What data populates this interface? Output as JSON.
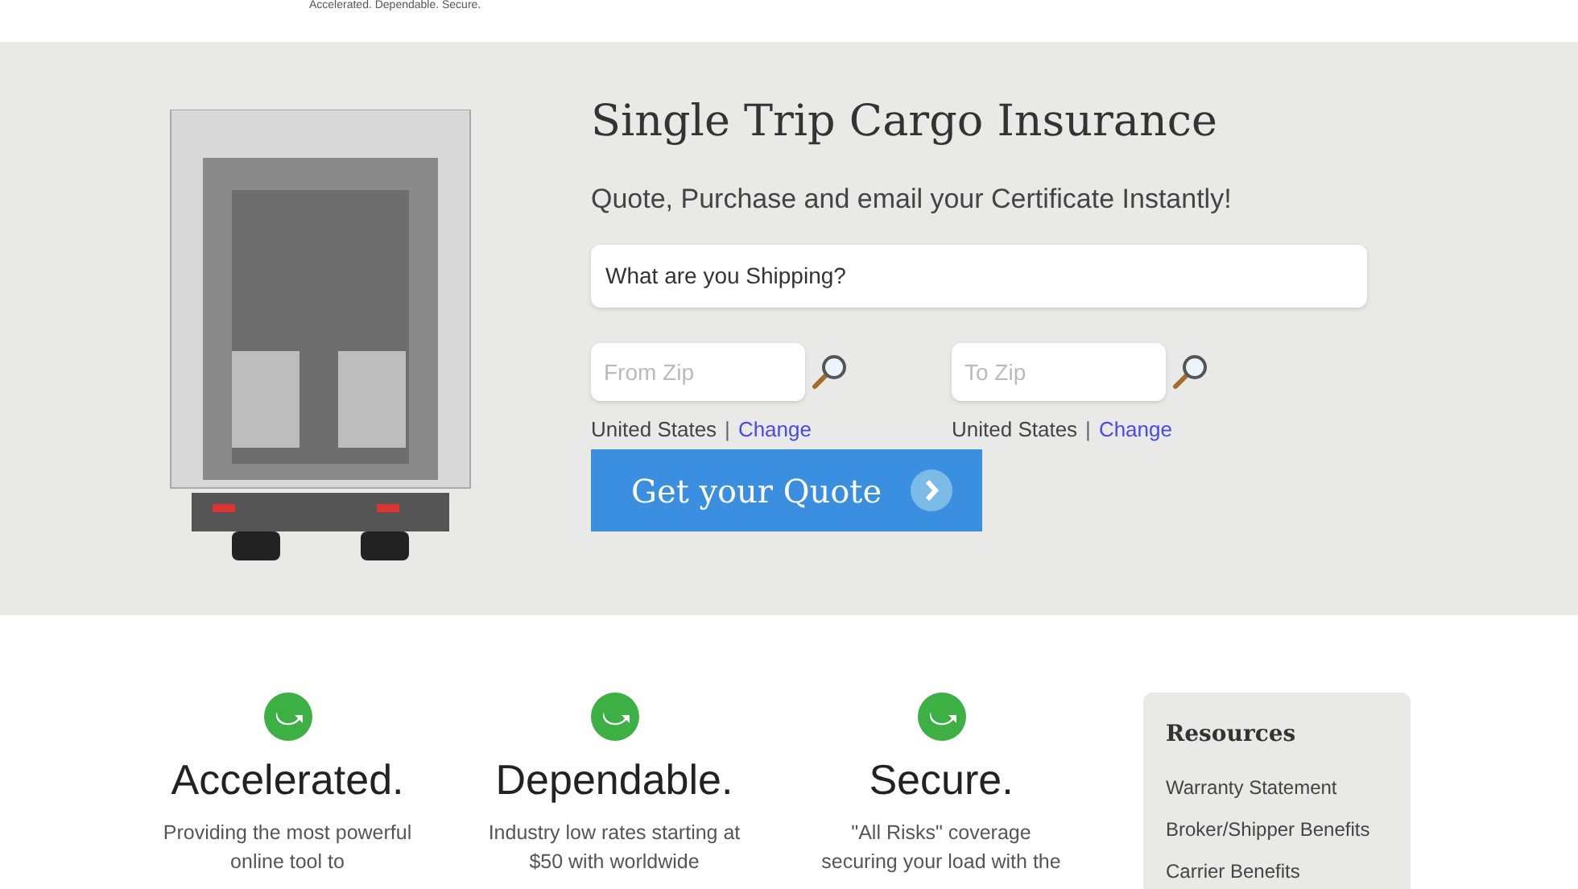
{
  "header": {
    "tagline": "Accelerated. Dependable. Secure."
  },
  "hero": {
    "title": "Single Trip Cargo Insurance",
    "subtitle": "Quote, Purchase and email your Certificate Instantly!",
    "shipping_field": {
      "value": "What are you Shipping?"
    },
    "zips": [
      {
        "placeholder": "From Zip",
        "country": "United States",
        "separator": "|",
        "link": "Change"
      },
      {
        "placeholder": "To Zip",
        "country": "United States",
        "separator": "|",
        "link": "Change"
      }
    ],
    "quote_button": "Get your Quote"
  },
  "features": [
    {
      "title": "Accelerated.",
      "text": "Providing the most powerful online tool to"
    },
    {
      "title": "Dependable.",
      "text": "Industry low rates starting at $50 with worldwide"
    },
    {
      "title": "Secure.",
      "text": "\"All Risks\" coverage securing your load with the"
    }
  ],
  "resources": {
    "title": "Resources",
    "links": [
      "Warranty Statement",
      "Broker/Shipper Benefits",
      "Carrier Benefits"
    ]
  }
}
